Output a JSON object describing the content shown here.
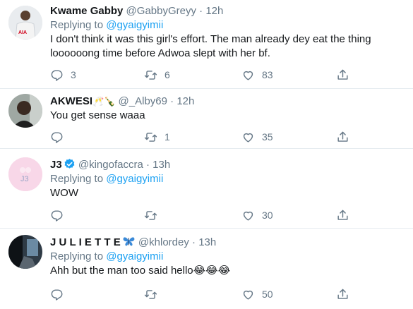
{
  "reply_prefix": "Replying to ",
  "tweets": [
    {
      "name": "Kwame Gabby",
      "handle": "@GabbyGreyy",
      "time": "12h",
      "reply_to": "@gyaigyimii",
      "text_lines": [
        "I don't think it was this girl's effort. The man already dey eat the thing",
        "loooooong time before Adwoa slept with her bf."
      ],
      "replies": "3",
      "retweets": "6",
      "likes": "83"
    },
    {
      "name": "AKWESI",
      "name_emoji": "🥂🍾",
      "handle": "@_Alby69",
      "time": "12h",
      "text": "You get sense waaa",
      "replies": "",
      "retweets": "1",
      "likes": "35"
    },
    {
      "name": "J3",
      "handle": "@kingofaccra",
      "time": "13h",
      "reply_to": "@gyaigyimii",
      "text": "WOW",
      "avatar_text": "J3",
      "replies": "",
      "retweets": "",
      "likes": "30"
    },
    {
      "name": "J U L I E T T E",
      "name_emoji": "🦋",
      "handle": "@khlordey",
      "time": "13h",
      "reply_to": "@gyaigyimii",
      "text": "Ahh but the man too said hello",
      "text_emoji": "😂😂😂",
      "replies": "",
      "retweets": "",
      "likes": "50"
    }
  ],
  "colors": {
    "link": "#1da1f2",
    "muted": "#657786",
    "border": "#e6ecf0"
  },
  "icons": [
    "reply-icon",
    "retweet-icon",
    "like-icon",
    "share-icon",
    "verified-badge-icon"
  ]
}
